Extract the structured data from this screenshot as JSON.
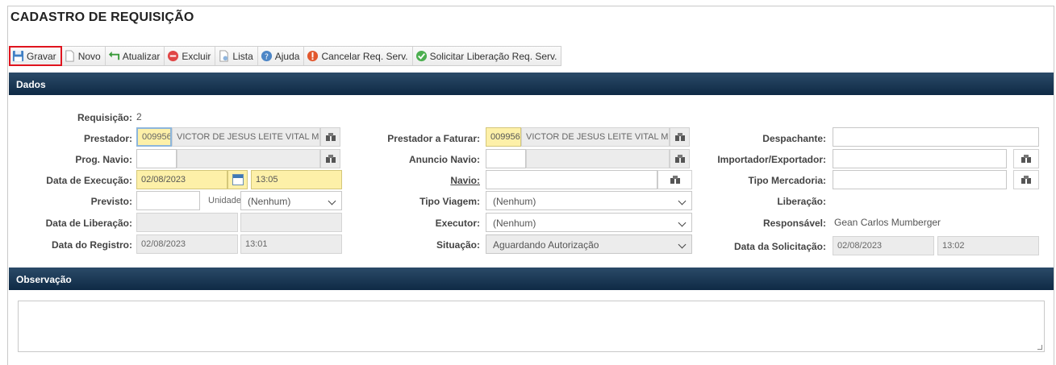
{
  "page": {
    "title": "CADASTRO DE REQUISIÇÃO"
  },
  "toolbar": {
    "gravar": "Gravar",
    "novo": "Novo",
    "atualizar": "Atualizar",
    "excluir": "Excluir",
    "lista": "Lista",
    "ajuda": "Ajuda",
    "cancelar": "Cancelar Req. Serv.",
    "solicitar": "Solicitar Liberação Req. Serv."
  },
  "sections": {
    "dados": "Dados",
    "observacao": "Observação"
  },
  "form": {
    "requisicao": {
      "label": "Requisição:",
      "value": "2"
    },
    "prestador": {
      "label": "Prestador:",
      "code": "009956",
      "name": "VICTOR DE JESUS LEITE VITAL ME"
    },
    "prog_navio": {
      "label": "Prog. Navio:",
      "value": ""
    },
    "data_execucao": {
      "label": "Data de Execução:",
      "date": "02/08/2023",
      "time": "13:05"
    },
    "previsto": {
      "label": "Previsto:",
      "value": "",
      "unit_label": "Unidade",
      "unit": "(Nenhum)"
    },
    "data_liberacao": {
      "label": "Data de Liberação:",
      "date": "",
      "time": ""
    },
    "data_registro": {
      "label": "Data do Registro:",
      "date": "02/08/2023",
      "time": "13:01"
    },
    "prestador_faturar": {
      "label": "Prestador a Faturar:",
      "code": "009956",
      "name": "VICTOR DE JESUS LEITE VITAL ME"
    },
    "anuncio_navio": {
      "label": "Anuncio Navio:",
      "value": ""
    },
    "navio": {
      "label": "Navio:",
      "value": ""
    },
    "tipo_viagem": {
      "label": "Tipo Viagem:",
      "value": "(Nenhum)"
    },
    "executor": {
      "label": "Executor:",
      "value": "(Nenhum)"
    },
    "situacao": {
      "label": "Situação:",
      "value": "Aguardando Autorização"
    },
    "despachante": {
      "label": "Despachante:",
      "value": ""
    },
    "importador": {
      "label": "Importador/Exportador:",
      "value": ""
    },
    "tipo_mercadoria": {
      "label": "Tipo Mercadoria:",
      "value": ""
    },
    "liberacao": {
      "label": "Liberação:",
      "value": ""
    },
    "responsavel": {
      "label": "Responsável:",
      "value": "Gean Carlos Mumberger"
    },
    "data_solicitacao": {
      "label": "Data da Solicitação:",
      "date": "02/08/2023",
      "time": "13:02"
    }
  },
  "observacao": {
    "value": ""
  },
  "colors": {
    "section_bar": "#0f2a45",
    "highlight": "#e0141e",
    "required_field": "#fdf0a8"
  },
  "icons": {
    "gravar": "save-icon",
    "novo": "new-document-icon",
    "atualizar": "refresh-icon",
    "excluir": "delete-icon",
    "lista": "list-icon",
    "ajuda": "help-icon",
    "cancelar": "cancel-icon",
    "solicitar": "check-icon",
    "lookup": "binoculars-icon",
    "calendar": "calendar-icon"
  }
}
